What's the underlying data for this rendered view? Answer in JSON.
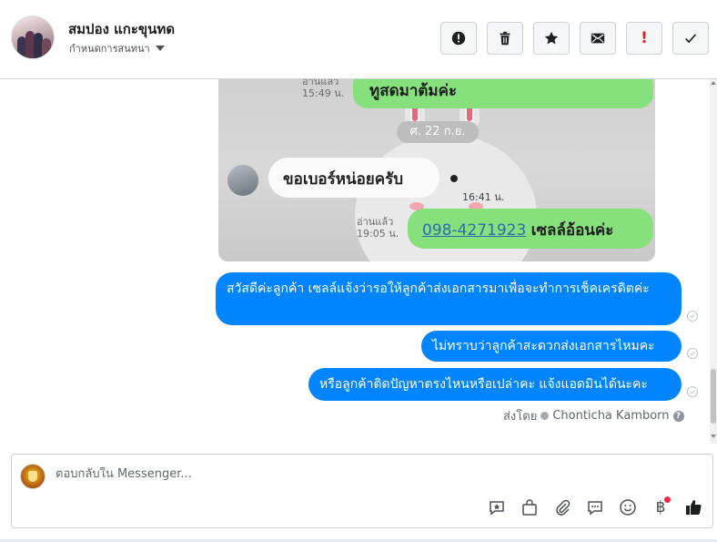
{
  "header": {
    "user_name": "สมปอง แกะขุนทด",
    "assign_label": "กำหนดการสนทนา",
    "actions": [
      {
        "name": "mark-spam",
        "icon": "exclamation-circle-icon"
      },
      {
        "name": "delete",
        "icon": "trash-icon"
      },
      {
        "name": "star",
        "icon": "star-icon"
      },
      {
        "name": "mark-unread",
        "icon": "envelope-icon"
      },
      {
        "name": "important",
        "icon": "exclamation-icon"
      },
      {
        "name": "done",
        "icon": "check-icon"
      }
    ]
  },
  "image_attachment": {
    "read_label_1": "อ่านแล้ว",
    "time_1": "15:49 น.",
    "green_text_1": "ทูสดมาต้มค่ะ",
    "date_pill": "ศ. 22 ก.ย.",
    "white_text": "ขอเบอร์หน่อยครับ",
    "time_2": "16:41 น.",
    "read_label_2": "อ่านแล้ว",
    "time_3": "19:05 น.",
    "phone": "098-4271923",
    "green_text_2": "เซลล์อ้อนค่ะ"
  },
  "messages": [
    {
      "text": "สวัสดีค่ะลูกค้า เซลล์แจ้งว่ารอให้ลูกค้าส่งเอกสารมาเพื่อจะทำการเช็คเครดิตค่ะ"
    },
    {
      "text": "ไม่ทราบว่าลูกค้าสะดวกส่งเอกสารไหมคะ"
    },
    {
      "text": "หรือลูกค้าติดปัญหาตรงไหนหรือเปล่าคะ แจ้งแอดมินได้นะคะ"
    }
  ],
  "sent_by": {
    "label": "ส่งโดย",
    "agent": "Chonticha Kamborn"
  },
  "composer": {
    "placeholder": "ตอบกลับใน Messenger...",
    "tools": [
      "saved-reply-icon",
      "shopping-bag-icon",
      "paperclip-icon",
      "chat-bubble-icon",
      "emoji-icon",
      "baht-payment-icon",
      "thumbs-up-icon"
    ],
    "baht_symbol": "฿"
  },
  "colors": {
    "messenger_blue": "#0084ff",
    "line_green": "#86e07c",
    "notification_red": "#f02849"
  }
}
